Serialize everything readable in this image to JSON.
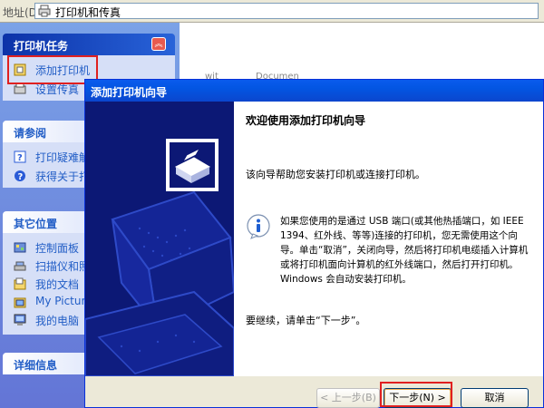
{
  "address_bar": {
    "label": "地址(D)",
    "value": "打印机和传真"
  },
  "task_pane": {
    "printer_tasks": {
      "title": "打印机任务",
      "items": [
        {
          "label": "添加打印机",
          "icon": "add-printer-icon"
        },
        {
          "label": "设置传真",
          "icon": "fax-icon"
        }
      ]
    },
    "see_also": {
      "title": "请参阅",
      "items": [
        {
          "label": "打印疑难解",
          "icon": "help-icon"
        },
        {
          "label": "获得关于打",
          "icon": "info-icon"
        }
      ]
    },
    "other_places": {
      "title": "其它位置",
      "items": [
        {
          "label": "控制面板",
          "icon": "control-panel-icon"
        },
        {
          "label": "扫描仪和照",
          "icon": "scanner-icon"
        },
        {
          "label": "我的文档",
          "icon": "documents-icon"
        },
        {
          "label": "My Picture",
          "icon": "pictures-icon"
        },
        {
          "label": "我的电脑",
          "icon": "computer-icon"
        }
      ]
    },
    "details": {
      "title": "详细信息"
    }
  },
  "background": {
    "fragment_1": "wit",
    "fragment_2": "Documen"
  },
  "wizard": {
    "title": "添加打印机向导",
    "heading": "欢迎使用添加打印机向导",
    "description": "该向导帮助您安装打印机或连接打印机。",
    "info_text": "如果您使用的是通过 USB 端口(或其他热插端口，如 IEEE 1394、红外线、等等)连接的打印机，您无需使用这个向导。单击“取消”，关闭向导，然后将打印机电缆插入计算机或将打印机面向计算机的红外线端口，然后打开打印机。Windows 会自动安装打印机。",
    "continue_text": "要继续，请单击“下一步”。",
    "back_label": "< 上一步(B)",
    "next_label": "下一步(N) >",
    "cancel_label": "取消"
  },
  "colors": {
    "taskpane_gradient_start": "#7ba2e7",
    "titlebar_blue": "#0a5bed",
    "highlight_red": "#e02020",
    "wizard_side_navy": "#0c1875"
  }
}
